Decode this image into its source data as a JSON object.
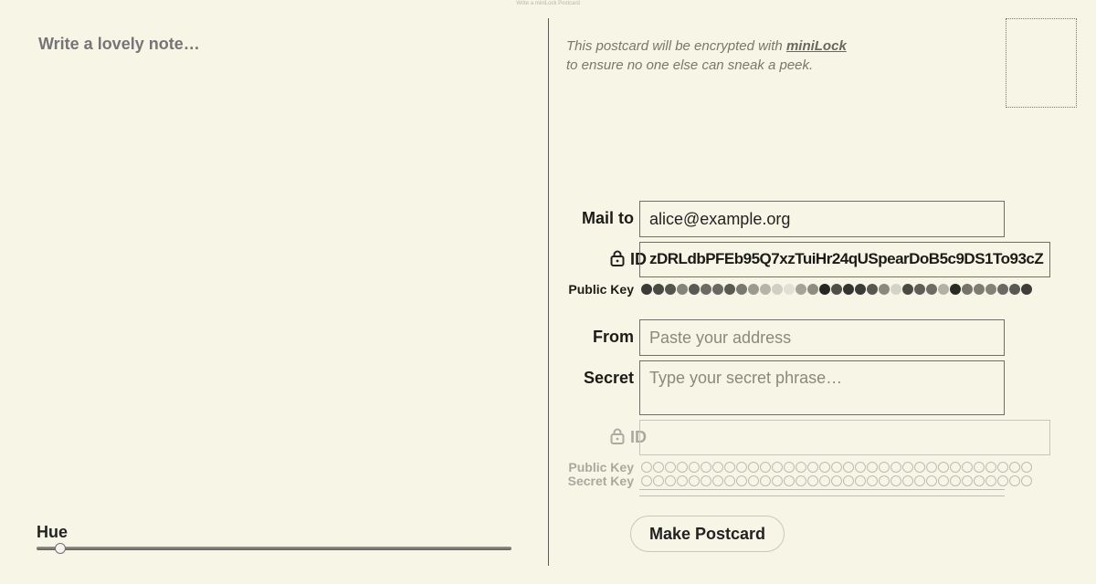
{
  "window_tag": "Write a miniLock Postcard",
  "note": {
    "placeholder": "Write a lovely note…"
  },
  "hue": {
    "label": "Hue",
    "value": 0.05
  },
  "encryption": {
    "line1_before": "This postcard will be encrypted with ",
    "link": "miniLock",
    "line2": "to ensure no one else can sneak a peek."
  },
  "mail_to": {
    "label": "Mail to",
    "value": "alice@example.org"
  },
  "recipient": {
    "id_prefix": "ID",
    "id_value": "zDRLdbPFEb95Q7xzTuiHr24qUSpearDoB5c9DS1To93cZ",
    "public_key_label": "Public Key",
    "public_key_dots": [
      "#3a3a36",
      "#4a4a45",
      "#555550",
      "#85847b",
      "#5a5a55",
      "#6a6963",
      "#686761",
      "#5a5a55",
      "#7a796f",
      "#9b9a90",
      "#b5b4a9",
      "#d0cfc4",
      "#e1e0d5",
      "#a4a398",
      "#8e8d82",
      "#262622",
      "#4f4e49",
      "#333330",
      "#3a3a36",
      "#585751",
      "#8a8980",
      "#d4d3c7",
      "#4a4a45",
      "#5f5e58",
      "#6d6c65",
      "#b2b1a6",
      "#2a2a27",
      "#74736b",
      "#7d7c73",
      "#838279",
      "#6a6963",
      "#5a5a55",
      "#3e3d39"
    ]
  },
  "from": {
    "label": "From",
    "placeholder": "Paste your address"
  },
  "secret": {
    "label": "Secret",
    "placeholder": "Type your secret phrase…"
  },
  "sender": {
    "id_prefix": "ID",
    "public_key_label": "Public Key",
    "secret_key_label": "Secret Key"
  },
  "make_button": "Make Postcard"
}
